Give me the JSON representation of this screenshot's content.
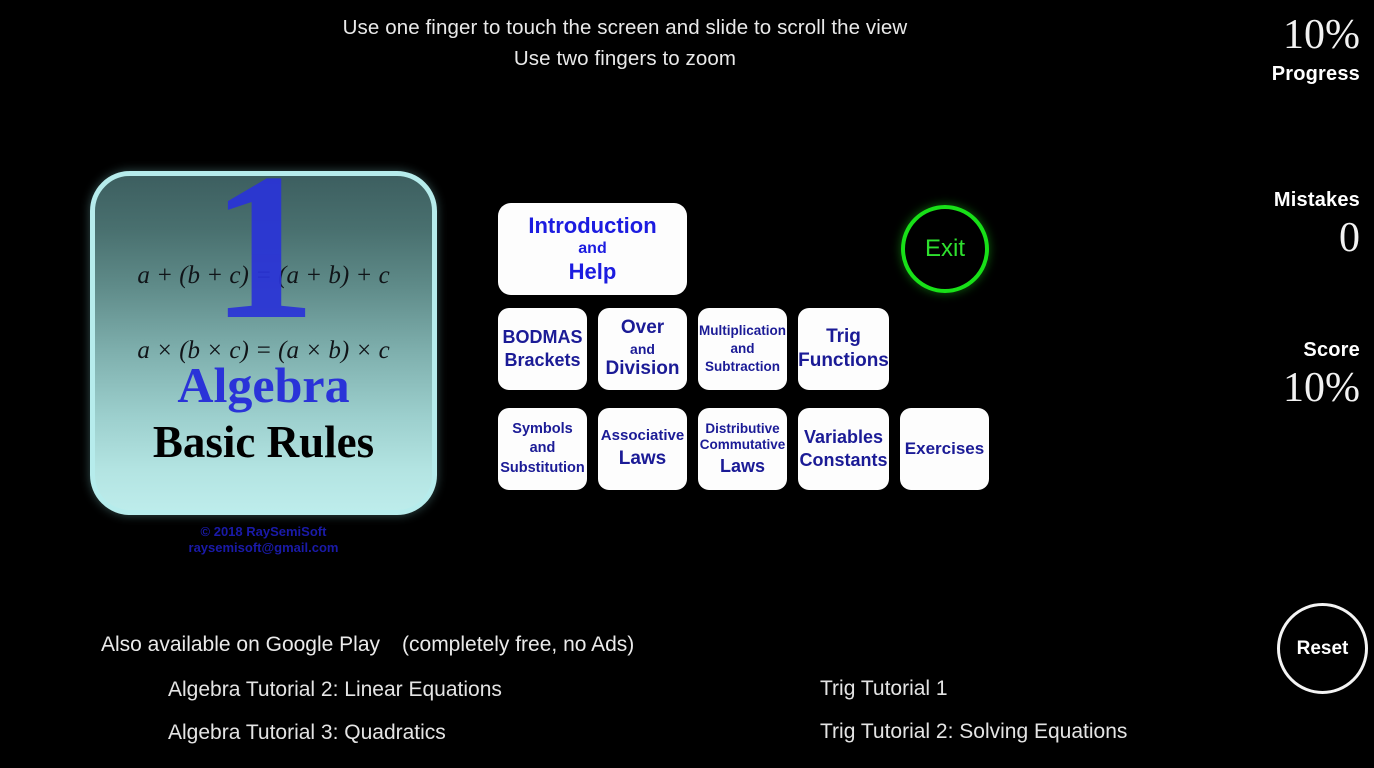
{
  "instructions": {
    "line1": "Use one finger to touch the screen and slide to scroll the view",
    "line2": "Use two fingers to zoom"
  },
  "stats": {
    "progress": {
      "value": "10%",
      "label": "Progress"
    },
    "mistakes": {
      "label": "Mistakes",
      "value": "0"
    },
    "score": {
      "label": "Score",
      "value": "10%"
    }
  },
  "cover": {
    "number": "1",
    "equation_1": "a + (b + c) = (a + b) + c",
    "equation_2": "a × (b × c) = (a × b) × c",
    "title": "Algebra",
    "subtitle": "Basic Rules",
    "copyright": "© 2018 RaySemiSoft",
    "email": "raysemisoft@gmail.com"
  },
  "menu": {
    "intro": {
      "l1": "Introduction",
      "l2": "and",
      "l3": "Help"
    },
    "bodmas": {
      "l1": "BODMAS",
      "l2": "Brackets"
    },
    "over_division": {
      "l1": "Over",
      "l2": "and",
      "l3": "Division"
    },
    "mult_subtraction": {
      "l1": "Multiplication",
      "l2": "and",
      "l3": "Subtraction"
    },
    "trig_functions": {
      "l1": "Trig",
      "l2": "Functions"
    },
    "symbols_substitution": {
      "l1": "Symbols",
      "l2": "and",
      "l3": "Substitution"
    },
    "associative_laws": {
      "l1": "Associative",
      "l2": "Laws"
    },
    "distributive_commutative": {
      "l1": "Distributive",
      "l2": "Commutative",
      "l3": "Laws"
    },
    "variables_constants": {
      "l1": "Variables",
      "l2": "Constants"
    },
    "exercises": {
      "l1": "Exercises"
    }
  },
  "actions": {
    "exit": "Exit",
    "reset": "Reset"
  },
  "promo": {
    "heading_main": "Also available on Google Play",
    "heading_note": "(completely free, no Ads)",
    "links": [
      "Algebra Tutorial 2: Linear Equations",
      "Algebra Tutorial 3: Quadratics",
      "Trig Tutorial 1",
      "Trig Tutorial 2: Solving Equations"
    ]
  },
  "colors": {
    "background": "#000000",
    "button_face": "#fdfdfd",
    "button_text": "#1b1b96",
    "intro_text": "#1c1ce0",
    "exit_green": "#18e018",
    "cover_accent": "#2a33d8",
    "credit_blue": "#1a1aa8"
  }
}
